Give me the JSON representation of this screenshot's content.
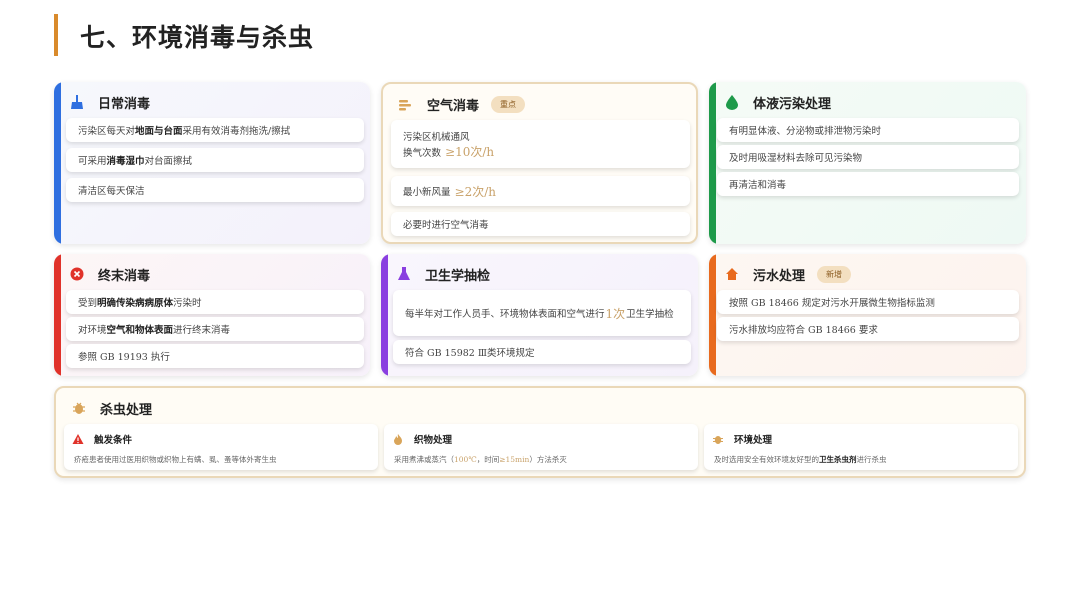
{
  "page": {
    "title": "七、环境消毒与杀虫"
  },
  "cards": {
    "daily": {
      "title": "日常消毒",
      "accent": "#2f6fe0",
      "items": [
        {
          "pre": "污染区每天对",
          "em": "地面与台面",
          "post": "采用有效消毒剂拖洗/擦拭"
        },
        {
          "pre": "可采用",
          "em": "消毒湿巾",
          "post": "对台面擦拭"
        },
        {
          "text": "清洁区每天保洁"
        }
      ]
    },
    "air": {
      "title": "空气消毒",
      "badge": "重点",
      "items": [
        {
          "line1": "污染区机械通风",
          "line2": "换气次数",
          "value": "≥10次/h"
        },
        {
          "text": "最小新风量",
          "value": "≥2次/h"
        },
        {
          "text": "必要时进行空气消毒"
        }
      ]
    },
    "fluid": {
      "title": "体液污染处理",
      "accent": "#1e9a4a",
      "items": [
        {
          "text": "有明显体液、分泌物或排泄物污染时"
        },
        {
          "text": "及时用吸湿材料去除可见污染物"
        },
        {
          "text": "再清洁和消毒"
        }
      ]
    },
    "terminal": {
      "title": "终末消毒",
      "accent": "#e0322a",
      "items": [
        {
          "pre": "受到",
          "em": "明确传染病病原体",
          "post": "污染时"
        },
        {
          "pre": "对环境",
          "em": "空气和物体表面",
          "post": "进行终末消毒"
        },
        {
          "text": "参照 GB 19193 执行"
        }
      ]
    },
    "sampling": {
      "title": "卫生学抽检",
      "accent": "#8a3fe0",
      "items": [
        {
          "pre": "每半年对工作人员手、环境物体表面和空气进行",
          "value": "1次",
          "post": "卫生学抽检"
        },
        {
          "text": "符合 GB 15982 Ⅲ类环境规定"
        }
      ]
    },
    "sewage": {
      "title": "污水处理",
      "badge": "新增",
      "accent": "#e86a1e",
      "items": [
        {
          "text": "按照 GB 18466 规定对污水开展微生物指标监测"
        },
        {
          "text": "污水排放均应符合 GB 18466 要求"
        }
      ]
    },
    "pest": {
      "title": "杀虫处理",
      "subs": [
        {
          "title": "触发条件",
          "text": "疥疮患者使用过医用织物或织物上有螨、虱、蚤等体外寄生虫"
        },
        {
          "title": "织物处理",
          "pre": "采用煮沸或蒸汽（",
          "v1": "100℃",
          "mid": "，时间",
          "v2": "≥15min",
          "post": "）方法杀灭"
        },
        {
          "title": "环境处理",
          "pre": "及时选用安全有效环境友好型的",
          "em": "卫生杀虫剂",
          "post": "进行杀虫"
        }
      ]
    }
  },
  "icons": {
    "daily": "broom-icon",
    "air": "fan-icon",
    "fluid": "droplet-icon",
    "terminal": "close-circle-icon",
    "sampling": "flask-icon",
    "sewage": "home-icon",
    "pest": "bug-icon",
    "trigger": "warning-icon",
    "textile": "fire-icon",
    "env": "bug-icon"
  }
}
